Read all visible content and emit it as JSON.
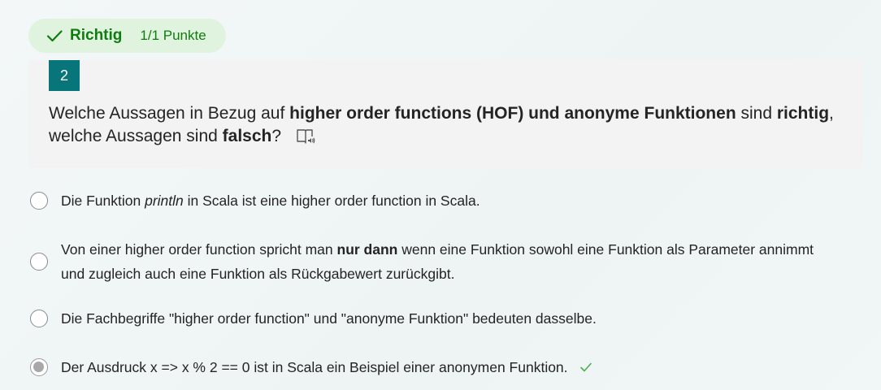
{
  "result": {
    "status": "Richtig",
    "points": "1/1 Punkte",
    "status_color": "#107c10",
    "pill_bg": "#dff3de"
  },
  "question": {
    "number": "2",
    "text_parts": [
      "Welche Aussagen in Bezug auf ",
      "higher order functions (HOF) und anonyme Funktionen",
      " sind ",
      "richtig",
      ",",
      "welche Aussagen sind ",
      "falsch",
      "?"
    ],
    "reader_icon": "immersive-reader-icon",
    "accent": "#077579"
  },
  "options": [
    {
      "parts": [
        "Die Funktion ",
        "println",
        " in Scala ist eine higher order function in Scala."
      ],
      "selected": false
    },
    {
      "parts": [
        "Von einer higher order function spricht man ",
        "nur dann",
        " wenn eine Funktion sowohl eine Funktion als Parameter annimmt",
        "und zugleich auch eine Funktion als Rückgabewert zurückgibt."
      ],
      "selected": false
    },
    {
      "parts": [
        "Die Fachbegriffe \"higher order function\" und \"anonyme Funktion\" bedeuten dasselbe."
      ],
      "selected": false
    },
    {
      "parts": [
        "Der Ausdruck x => x % 2 == 0 ist in Scala ein Beispiel einer anonymen Funktion."
      ],
      "selected": true,
      "correct_mark": "check-icon"
    }
  ]
}
